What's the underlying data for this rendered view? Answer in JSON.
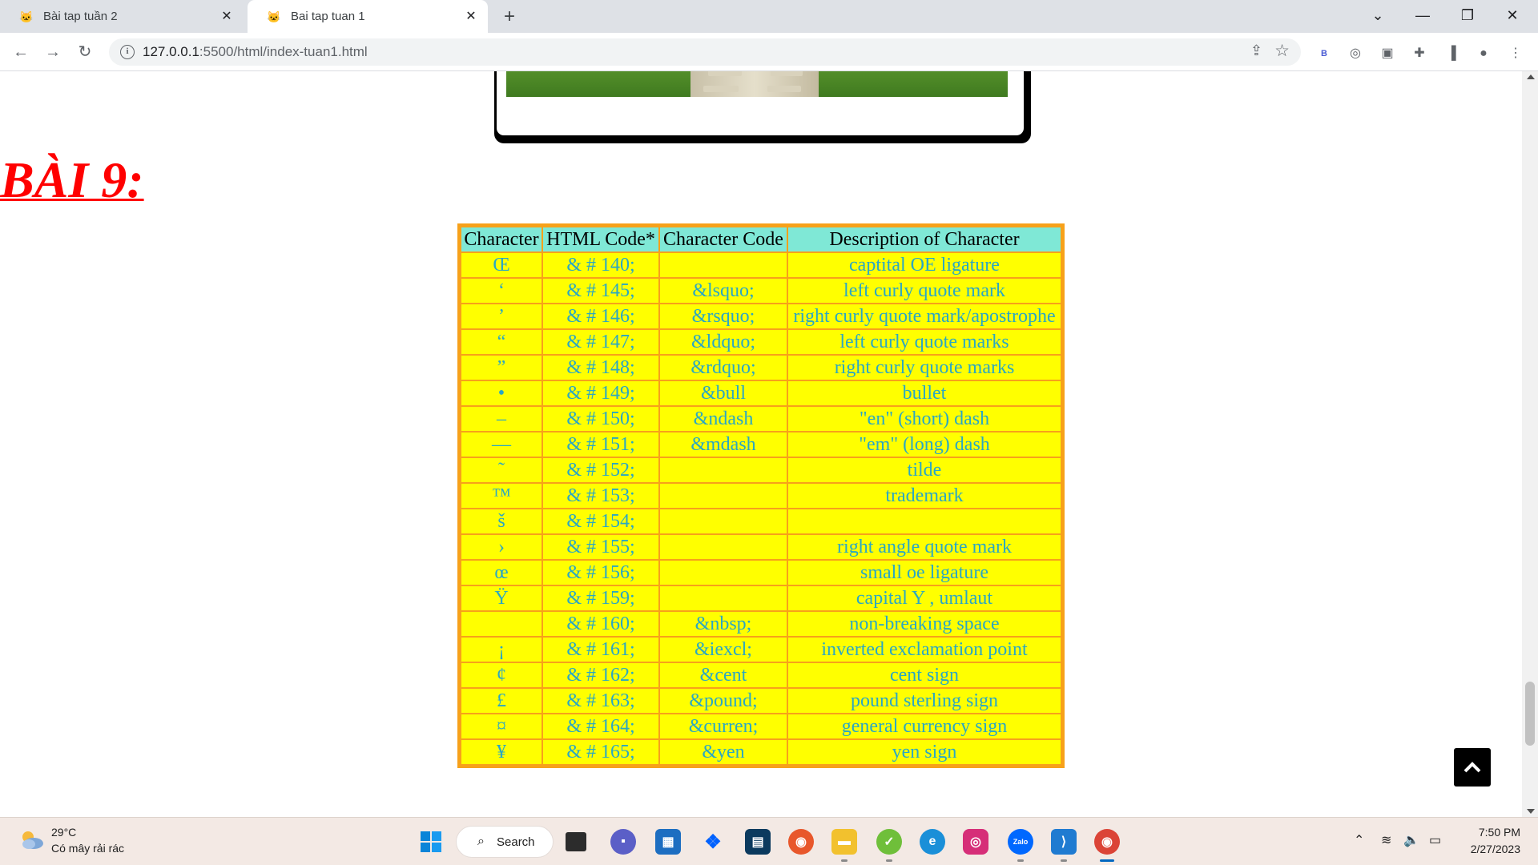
{
  "browser": {
    "tabs": [
      {
        "title": "Bài tap tuần 2",
        "active": false
      },
      {
        "title": "Bai tap tuan 1",
        "active": true
      }
    ],
    "url_host": "127.0.0.1",
    "url_rest": ":5500/html/index-tuan1.html",
    "extension_badge": "B"
  },
  "page": {
    "heading": "BÀI 9:",
    "table": {
      "headers": [
        "Character",
        "HTML Code*",
        "Character Code",
        "Description of Character"
      ],
      "rows": [
        [
          "Œ",
          "& # 140;",
          "",
          "captital OE ligature"
        ],
        [
          "‘",
          "& # 145;",
          "&lsquo;",
          "left curly quote mark"
        ],
        [
          "’",
          "& # 146;",
          "&rsquo;",
          "right curly quote mark/apostrophe"
        ],
        [
          "“",
          "& # 147;",
          "&ldquo;",
          "left curly quote marks"
        ],
        [
          "”",
          "& # 148;",
          "&rdquo;",
          "right curly quote marks"
        ],
        [
          "•",
          "& # 149;",
          "&bull",
          "bullet"
        ],
        [
          "–",
          "& # 150;",
          "&ndash",
          "\"en\" (short) dash"
        ],
        [
          "—",
          "& # 151;",
          "&mdash",
          "\"em\" (long) dash"
        ],
        [
          "˜",
          "& # 152;",
          "",
          "tilde"
        ],
        [
          "™",
          "& # 153;",
          "",
          "trademark"
        ],
        [
          "š",
          "& # 154;",
          "",
          ""
        ],
        [
          "›",
          "& # 155;",
          "",
          "right angle quote mark"
        ],
        [
          "œ",
          "& # 156;",
          "",
          "small oe ligature"
        ],
        [
          "Ÿ",
          "& # 159;",
          "",
          "capital Y , umlaut"
        ],
        [
          "",
          "& # 160;",
          "&nbsp;",
          "non-breaking space"
        ],
        [
          "¡",
          "& # 161;",
          "&iexcl;",
          "inverted exclamation point"
        ],
        [
          "¢",
          "& # 162;",
          "&cent",
          "cent sign"
        ],
        [
          "£",
          "& # 163;",
          "&pound;",
          "pound sterling sign"
        ],
        [
          "¤",
          "& # 164;",
          "&curren;",
          "general currency sign"
        ],
        [
          "¥",
          "& # 165;",
          "&yen",
          "yen sign"
        ]
      ]
    }
  },
  "taskbar": {
    "weather_temp": "29°C",
    "weather_desc": "Có mây rải rác",
    "search_label": "Search",
    "apps": [
      "start-icon",
      "task-view-icon",
      "teams-chat-icon",
      "store-icon",
      "dropbox-icon",
      "terminal-icon",
      "firefox-icon",
      "file-explorer-icon",
      "coccoc-icon",
      "edge-icon",
      "instagram-icon",
      "zalo-icon",
      "vscode-icon",
      "chrome-icon"
    ],
    "zalo_label": "Zalo",
    "time": "7:50 PM",
    "date": "2/27/2023"
  },
  "colors": {
    "heading": "#ff0000",
    "table_border": "#f7a11a",
    "header_bg": "#7fe8d6",
    "cell_bg": "#ffff00",
    "cell_text": "#2aa7c4"
  }
}
